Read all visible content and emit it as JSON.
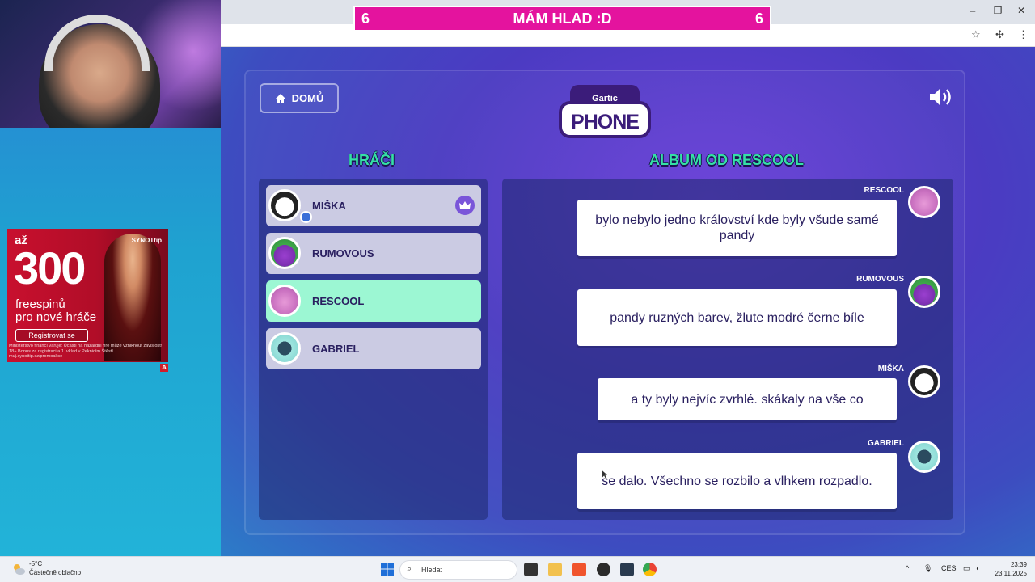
{
  "banner": {
    "left_count": "6",
    "title": "MÁM HLAD :D",
    "right_count": "6"
  },
  "game": {
    "home_label": "DOMŮ",
    "logo_small": "Gartic",
    "logo_big": "PHONE",
    "players_heading": "HRÁČI",
    "album_heading": "ALBUM OD RESCOOL"
  },
  "players": [
    {
      "name": "MIŠKA",
      "avatar": "panda-avatar",
      "host": true,
      "active": false
    },
    {
      "name": "RUMOVOUS",
      "avatar": "green-monster-avatar",
      "host": false,
      "active": false
    },
    {
      "name": "RESCOOL",
      "avatar": "pink-monster-avatar",
      "host": false,
      "active": true
    },
    {
      "name": "GABRIEL",
      "avatar": "robot-avatar",
      "host": false,
      "active": false
    }
  ],
  "album": [
    {
      "author": "RESCOOL",
      "text": "bylo nebylo jedno království kde byly všude samé pandy"
    },
    {
      "author": "RUMOVOUS",
      "text": "pandy ruzných barev, žlute modré černe bíle"
    },
    {
      "author": "MIŠKA",
      "text": "a ty byly nejvíc zvrhlé. skákaly na vše co"
    },
    {
      "author": "GABRIEL",
      "text": "se dalo. Všechno se rozbilo a vlhkem rozpadlo."
    }
  ],
  "ad": {
    "prefix": "až",
    "amount": "300",
    "line1": "freespinů",
    "line2": "pro nové hráče",
    "button": "Registrovat se",
    "brand": "SYNOTtip",
    "fine_print": "Ministerstvo financí varuje: Účastí na hazardní hře může vzniknout závislost! 18+ Bonus za registraci a 1. vklad v Peknicím Štěstí. muj.synottip.cz/promoakce",
    "badge": "A"
  },
  "taskbar": {
    "temperature": "-5°C",
    "weather": "Částečně oblačno",
    "search_placeholder": "Hledat",
    "language": "CES",
    "time": "23:39",
    "date": "23.11.2025"
  },
  "colors": {
    "banner": "#e4139e",
    "heading": "#35e0a6",
    "active_player": "#9cf7d3",
    "player": "#cbcbe3"
  }
}
